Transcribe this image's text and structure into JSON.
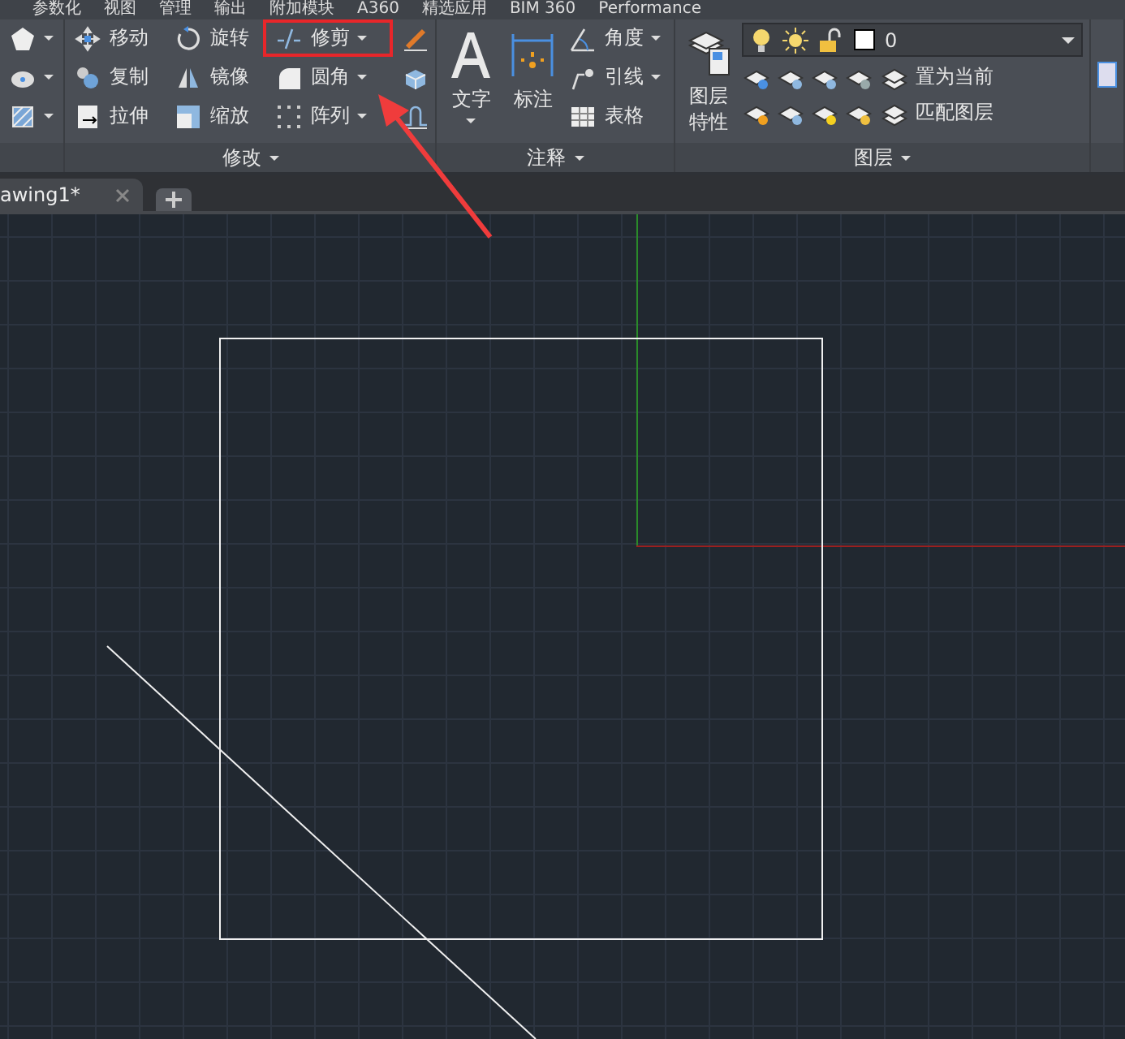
{
  "menu_tabs": [
    {
      "label": "参数化"
    },
    {
      "label": "视图"
    },
    {
      "label": "管理"
    },
    {
      "label": "输出"
    },
    {
      "label": "附加模块"
    },
    {
      "label": "A360"
    },
    {
      "label": "精选应用"
    },
    {
      "label": "BIM 360"
    },
    {
      "label": "Performance"
    }
  ],
  "modify_panel": {
    "title": "修改",
    "tools": [
      {
        "label": "移动",
        "dropdown": false,
        "highlighted": false
      },
      {
        "label": "复制",
        "dropdown": false,
        "highlighted": false
      },
      {
        "label": "拉伸",
        "dropdown": false,
        "highlighted": false
      },
      {
        "label": "旋转",
        "dropdown": false,
        "highlighted": false
      },
      {
        "label": "镜像",
        "dropdown": false,
        "highlighted": false
      },
      {
        "label": "缩放",
        "dropdown": false,
        "highlighted": false
      },
      {
        "label": "修剪",
        "dropdown": true,
        "highlighted": true
      },
      {
        "label": "圆角",
        "dropdown": true,
        "highlighted": false
      },
      {
        "label": "阵列",
        "dropdown": true,
        "highlighted": false
      }
    ]
  },
  "annotation_panel": {
    "title": "注释",
    "text_tool": "文字",
    "dimension_tool": "标注",
    "tools": [
      {
        "label": "角度",
        "dropdown": true
      },
      {
        "label": "引线",
        "dropdown": true
      },
      {
        "label": "表格",
        "dropdown": false
      }
    ]
  },
  "layer_panel": {
    "title": "图层",
    "properties_tool": "图层特性",
    "layer_dropdown": {
      "value": "0"
    },
    "tools": [
      {
        "label": "置为当前"
      },
      {
        "label": "匹配图层"
      }
    ]
  },
  "document_tabs": [
    {
      "label": "awing1*",
      "selected": true
    }
  ]
}
